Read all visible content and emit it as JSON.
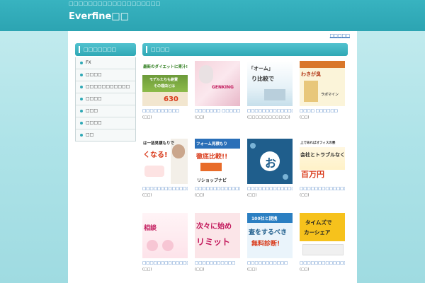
{
  "header": {
    "tagline": "□□□□□□□□□□□□□□□□□□□",
    "logo": "Everfine□□"
  },
  "top_link": "□□□□□",
  "sidebar": {
    "title": "□□□□□□□",
    "items": [
      {
        "label": "FX"
      },
      {
        "label": "□□□□"
      },
      {
        "label": "□□□□□□□□□□□"
      },
      {
        "label": "□□□□"
      },
      {
        "label": "□□□"
      },
      {
        "label": "□□□□"
      },
      {
        "label": "□□"
      }
    ]
  },
  "main": {
    "title": "□□□□",
    "cards": [
      {
        "title": "□□□□□□□□□□",
        "meta": "(□□)",
        "img": {
          "t1": "最新のダイエットに青汁!",
          "t2": "モデルたちも絶賛",
          "t3": "その理由とは",
          "price": "630"
        }
      },
      {
        "title": "□□□□□□□ □□□□□□",
        "meta": "(□□)",
        "img": {
          "t1": "GENKING"
        }
      },
      {
        "title": "□□□□□□□□□□□□□□□□",
        "meta": "(□□□□□□□□□□□□)",
        "img": {
          "t1": "「オーム」",
          "t2": "り比較で"
        }
      },
      {
        "title": "□□□□ □□□□□□",
        "meta": "(□□)",
        "img": {
          "t1": "わきが臭",
          "t2": "ラボマイン"
        }
      },
      {
        "title": "□□□□□□□□□□□□□□□□",
        "meta": "(□□)",
        "img": {
          "t1": "は一括見積もりで",
          "t2": "くなる!"
        }
      },
      {
        "title": "□□□□□□□□□□□□□□□□",
        "meta": "(□□)",
        "img": {
          "t1": "フォーム見積もり",
          "t2": "徹底比較!!",
          "t3": "リショップナビ"
        }
      },
      {
        "title": "□□□□□□□□□□□□□□□□",
        "meta": "(□□)",
        "img": {
          "t1": "お"
        }
      },
      {
        "title": "□□□□□□□□□□□□□□□□",
        "meta": "(□□)",
        "img": {
          "t1": "上であればオフィスの悪",
          "t2": "会社とトラブルなく",
          "t3": "百万円"
        }
      },
      {
        "title": "□□□□□□□□□□□□□",
        "meta": "(□□)",
        "img": {
          "t1": "相談"
        }
      },
      {
        "title": "□□□□□□□□□□□",
        "meta": "(□□)",
        "img": {
          "t1": "次々に始め",
          "t2": "リミット"
        }
      },
      {
        "title": "□□□□□□□□□□□",
        "meta": "(□□)",
        "img": {
          "t1": "100社と提携",
          "t2": "査をするべき",
          "t3": "無料診断!"
        }
      },
      {
        "title": "□□□□□□□□□□□□□□□",
        "meta": "(□□)",
        "img": {
          "t1": "タイムズで",
          "t2": "カーシェア"
        }
      }
    ]
  },
  "colors": {
    "accent": "#2fa8b5",
    "link": "#1a5fb4",
    "background": "#aee3e8"
  }
}
